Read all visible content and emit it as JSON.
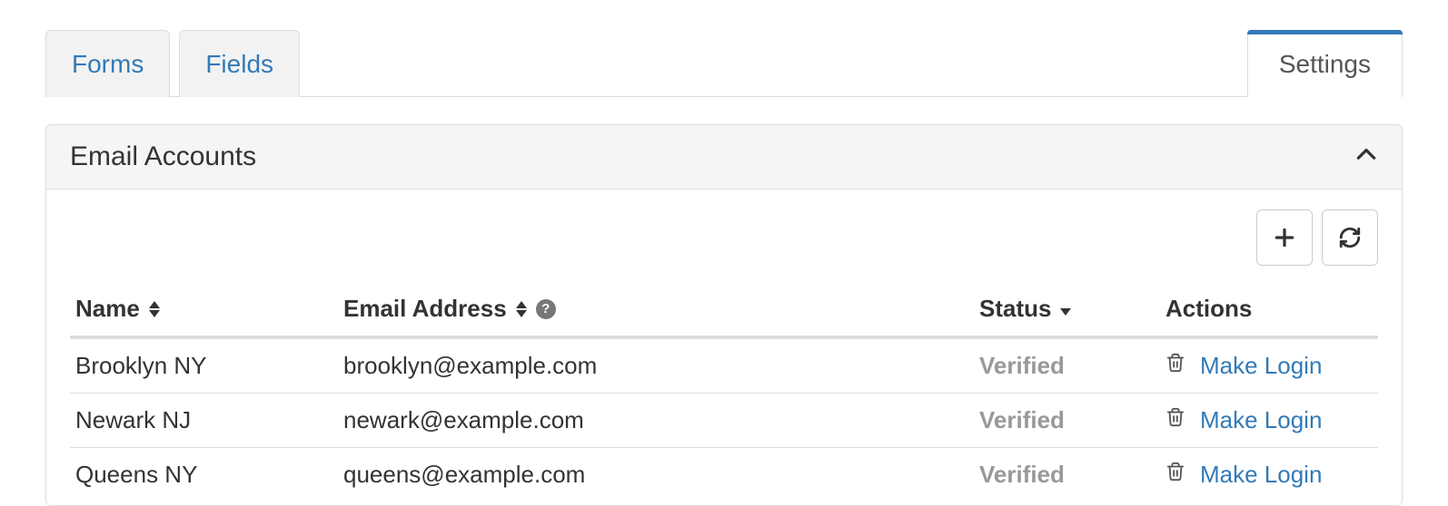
{
  "tabs": {
    "forms": "Forms",
    "fields": "Fields",
    "settings": "Settings"
  },
  "panel": {
    "title": "Email Accounts"
  },
  "table": {
    "columns": {
      "name": "Name",
      "email": "Email Address",
      "status": "Status",
      "actions": "Actions"
    },
    "rows": [
      {
        "name": "Brooklyn NY",
        "email": "brooklyn@example.com",
        "status": "Verified",
        "action_label": "Make Login"
      },
      {
        "name": "Newark NJ",
        "email": "newark@example.com",
        "status": "Verified",
        "action_label": "Make Login"
      },
      {
        "name": "Queens NY",
        "email": "queens@example.com",
        "status": "Verified",
        "action_label": "Make Login"
      }
    ]
  }
}
